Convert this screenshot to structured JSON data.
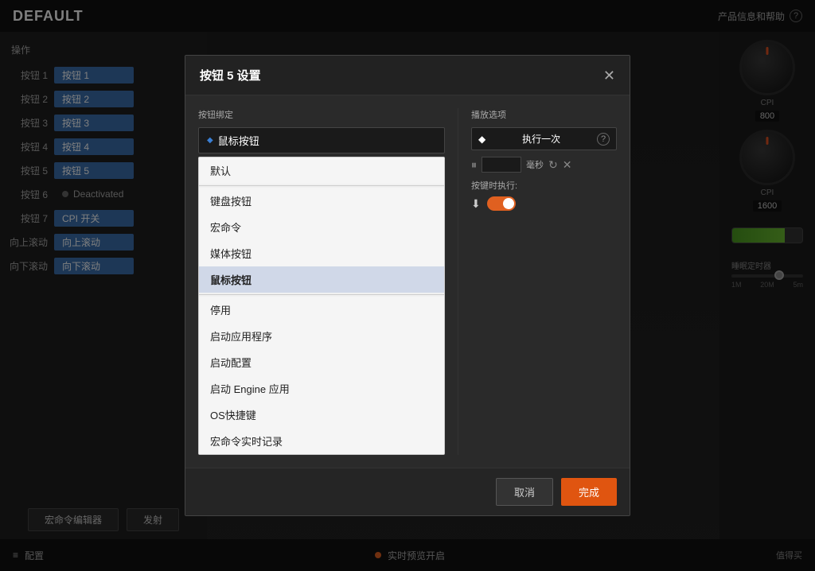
{
  "app": {
    "title": "DEFAULT",
    "top_right": "产品信息和帮助",
    "help_icon": "?"
  },
  "left_panel": {
    "header": "操作",
    "buttons": [
      {
        "label": "按钮 1",
        "value": "按钮 1",
        "style": "active"
      },
      {
        "label": "按钮 2",
        "value": "按钮 2",
        "style": "active"
      },
      {
        "label": "按钮 3",
        "value": "按钮 3",
        "style": "active"
      },
      {
        "label": "按钮 4",
        "value": "按钮 4",
        "style": "active"
      },
      {
        "label": "按钮 5",
        "value": "按钮 5",
        "style": "active"
      },
      {
        "label": "按钮 6",
        "value": "Deactivated",
        "style": "deactivated"
      },
      {
        "label": "按钮 7",
        "value": "CPI 开关",
        "style": "active"
      },
      {
        "label": "向上滚动",
        "value": "向上滚动",
        "style": "active"
      },
      {
        "label": "向下滚动",
        "value": "向下滚动",
        "style": "active"
      }
    ],
    "macro_editor": "宏命令编辑器",
    "fire_button": "发射"
  },
  "right_panel": {
    "knob1": {
      "label": "CPI",
      "value": "800"
    },
    "knob2": {
      "label": "CPI",
      "value": "1600"
    },
    "battery_label": "",
    "sleep_label": "睡眠定时器",
    "slider_min": "1M",
    "slider_mid": "20M",
    "slider_max": "5m"
  },
  "bottom_bar": {
    "config_icon": "≡",
    "config_label": "配置",
    "preview_dot": "●",
    "preview_label": "实时预览开启",
    "watermark": "值得买"
  },
  "modal": {
    "title": "按钮 5 设置",
    "close": "✕",
    "binding_label": "按钮绑定",
    "dropdown_selected": "鼠标按钮",
    "dropdown_arrow": "◆",
    "items": [
      {
        "text": "默认",
        "style": "normal"
      },
      {
        "text": "键盘按钮",
        "style": "normal"
      },
      {
        "text": "宏命令",
        "style": "normal"
      },
      {
        "text": "媒体按钮",
        "style": "normal"
      },
      {
        "text": "鼠标按钮",
        "style": "selected"
      },
      {
        "text": "停用",
        "style": "normal"
      },
      {
        "text": "启动应用程序",
        "style": "normal"
      },
      {
        "text": "启动配置",
        "style": "normal"
      },
      {
        "text": "启动 Engine 应用",
        "style": "normal"
      },
      {
        "text": "OS快捷键",
        "style": "normal"
      },
      {
        "text": "宏命令实时记录",
        "style": "normal"
      }
    ],
    "playback_label": "播放选项",
    "playback_selected": "执行一次",
    "playback_help": "?",
    "time_unit": "毫秒",
    "exec_label": "按键时执行:",
    "toggle_state": "on",
    "cancel_label": "取消",
    "confirm_label": "完成"
  }
}
